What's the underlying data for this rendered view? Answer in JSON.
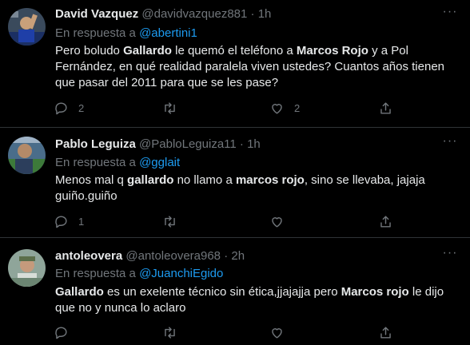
{
  "reply_prefix": "En respuesta a",
  "tweets": [
    {
      "name": "David Vazquez",
      "handle": "@davidvazquez881",
      "dot": "·",
      "time": "1h",
      "reply_to": "@abertini1",
      "text": [
        {
          "t": "Pero boludo ",
          "b": false
        },
        {
          "t": "Gallardo",
          "b": true
        },
        {
          "t": " le quemó el teléfono a ",
          "b": false
        },
        {
          "t": "Marcos Rojo",
          "b": true
        },
        {
          "t": " y a Pol Fernández, en qué realidad paralela viven ustedes? Cuantos años tienen que pasar del 2011 para que se les pase?",
          "b": false
        }
      ],
      "replies": "2",
      "retweets": "",
      "likes": "2"
    },
    {
      "name": "Pablo Leguiza",
      "handle": "@PabloLeguiza11",
      "dot": "·",
      "time": "1h",
      "reply_to": "@gglait",
      "text": [
        {
          "t": "Menos mal q ",
          "b": false
        },
        {
          "t": "gallardo",
          "b": true
        },
        {
          "t": " no llamo a ",
          "b": false
        },
        {
          "t": "marcos rojo",
          "b": true
        },
        {
          "t": ", sino se llevaba, jajaja guiño.guiño",
          "b": false
        }
      ],
      "replies": "1",
      "retweets": "",
      "likes": ""
    },
    {
      "name": "antoleovera",
      "handle": "@antoleovera968",
      "dot": "·",
      "time": "2h",
      "reply_to": "@JuanchiEgido",
      "text": [
        {
          "t": "Gallardo",
          "b": true
        },
        {
          "t": " es un exelente técnico  sin ética,jjajajja pero ",
          "b": false
        },
        {
          "t": "Marcos rojo",
          "b": true
        },
        {
          "t": " le dijo que no y nunca lo aclaro",
          "b": false
        }
      ],
      "replies": "",
      "retweets": "",
      "likes": ""
    }
  ],
  "colors": {
    "background": "#000000",
    "text": "#e7e9ea",
    "muted": "#71767b",
    "link": "#1d9bf0",
    "divider": "#2f3336"
  },
  "icons": {
    "reply": "speech-bubble-icon",
    "retweet": "retweet-arrows-icon",
    "like": "heart-icon",
    "share": "share-upload-icon",
    "more": "ellipsis-icon"
  }
}
